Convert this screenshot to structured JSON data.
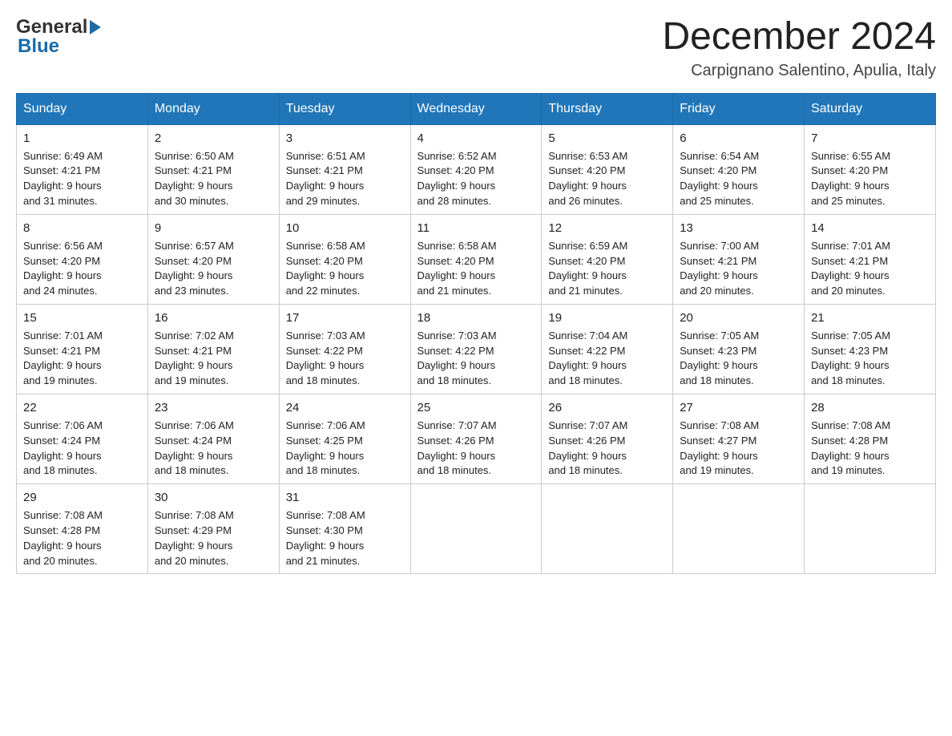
{
  "header": {
    "logo_main": "General",
    "logo_sub": "Blue",
    "month_title": "December 2024",
    "subtitle": "Carpignano Salentino, Apulia, Italy"
  },
  "weekdays": [
    "Sunday",
    "Monday",
    "Tuesday",
    "Wednesday",
    "Thursday",
    "Friday",
    "Saturday"
  ],
  "weeks": [
    [
      {
        "day": "1",
        "sunrise": "6:49 AM",
        "sunset": "4:21 PM",
        "daylight": "9 hours and 31 minutes."
      },
      {
        "day": "2",
        "sunrise": "6:50 AM",
        "sunset": "4:21 PM",
        "daylight": "9 hours and 30 minutes."
      },
      {
        "day": "3",
        "sunrise": "6:51 AM",
        "sunset": "4:21 PM",
        "daylight": "9 hours and 29 minutes."
      },
      {
        "day": "4",
        "sunrise": "6:52 AM",
        "sunset": "4:20 PM",
        "daylight": "9 hours and 28 minutes."
      },
      {
        "day": "5",
        "sunrise": "6:53 AM",
        "sunset": "4:20 PM",
        "daylight": "9 hours and 26 minutes."
      },
      {
        "day": "6",
        "sunrise": "6:54 AM",
        "sunset": "4:20 PM",
        "daylight": "9 hours and 25 minutes."
      },
      {
        "day": "7",
        "sunrise": "6:55 AM",
        "sunset": "4:20 PM",
        "daylight": "9 hours and 25 minutes."
      }
    ],
    [
      {
        "day": "8",
        "sunrise": "6:56 AM",
        "sunset": "4:20 PM",
        "daylight": "9 hours and 24 minutes."
      },
      {
        "day": "9",
        "sunrise": "6:57 AM",
        "sunset": "4:20 PM",
        "daylight": "9 hours and 23 minutes."
      },
      {
        "day": "10",
        "sunrise": "6:58 AM",
        "sunset": "4:20 PM",
        "daylight": "9 hours and 22 minutes."
      },
      {
        "day": "11",
        "sunrise": "6:58 AM",
        "sunset": "4:20 PM",
        "daylight": "9 hours and 21 minutes."
      },
      {
        "day": "12",
        "sunrise": "6:59 AM",
        "sunset": "4:20 PM",
        "daylight": "9 hours and 21 minutes."
      },
      {
        "day": "13",
        "sunrise": "7:00 AM",
        "sunset": "4:21 PM",
        "daylight": "9 hours and 20 minutes."
      },
      {
        "day": "14",
        "sunrise": "7:01 AM",
        "sunset": "4:21 PM",
        "daylight": "9 hours and 20 minutes."
      }
    ],
    [
      {
        "day": "15",
        "sunrise": "7:01 AM",
        "sunset": "4:21 PM",
        "daylight": "9 hours and 19 minutes."
      },
      {
        "day": "16",
        "sunrise": "7:02 AM",
        "sunset": "4:21 PM",
        "daylight": "9 hours and 19 minutes."
      },
      {
        "day": "17",
        "sunrise": "7:03 AM",
        "sunset": "4:22 PM",
        "daylight": "9 hours and 18 minutes."
      },
      {
        "day": "18",
        "sunrise": "7:03 AM",
        "sunset": "4:22 PM",
        "daylight": "9 hours and 18 minutes."
      },
      {
        "day": "19",
        "sunrise": "7:04 AM",
        "sunset": "4:22 PM",
        "daylight": "9 hours and 18 minutes."
      },
      {
        "day": "20",
        "sunrise": "7:05 AM",
        "sunset": "4:23 PM",
        "daylight": "9 hours and 18 minutes."
      },
      {
        "day": "21",
        "sunrise": "7:05 AM",
        "sunset": "4:23 PM",
        "daylight": "9 hours and 18 minutes."
      }
    ],
    [
      {
        "day": "22",
        "sunrise": "7:06 AM",
        "sunset": "4:24 PM",
        "daylight": "9 hours and 18 minutes."
      },
      {
        "day": "23",
        "sunrise": "7:06 AM",
        "sunset": "4:24 PM",
        "daylight": "9 hours and 18 minutes."
      },
      {
        "day": "24",
        "sunrise": "7:06 AM",
        "sunset": "4:25 PM",
        "daylight": "9 hours and 18 minutes."
      },
      {
        "day": "25",
        "sunrise": "7:07 AM",
        "sunset": "4:26 PM",
        "daylight": "9 hours and 18 minutes."
      },
      {
        "day": "26",
        "sunrise": "7:07 AM",
        "sunset": "4:26 PM",
        "daylight": "9 hours and 18 minutes."
      },
      {
        "day": "27",
        "sunrise": "7:08 AM",
        "sunset": "4:27 PM",
        "daylight": "9 hours and 19 minutes."
      },
      {
        "day": "28",
        "sunrise": "7:08 AM",
        "sunset": "4:28 PM",
        "daylight": "9 hours and 19 minutes."
      }
    ],
    [
      {
        "day": "29",
        "sunrise": "7:08 AM",
        "sunset": "4:28 PM",
        "daylight": "9 hours and 20 minutes."
      },
      {
        "day": "30",
        "sunrise": "7:08 AM",
        "sunset": "4:29 PM",
        "daylight": "9 hours and 20 minutes."
      },
      {
        "day": "31",
        "sunrise": "7:08 AM",
        "sunset": "4:30 PM",
        "daylight": "9 hours and 21 minutes."
      },
      null,
      null,
      null,
      null
    ]
  ]
}
